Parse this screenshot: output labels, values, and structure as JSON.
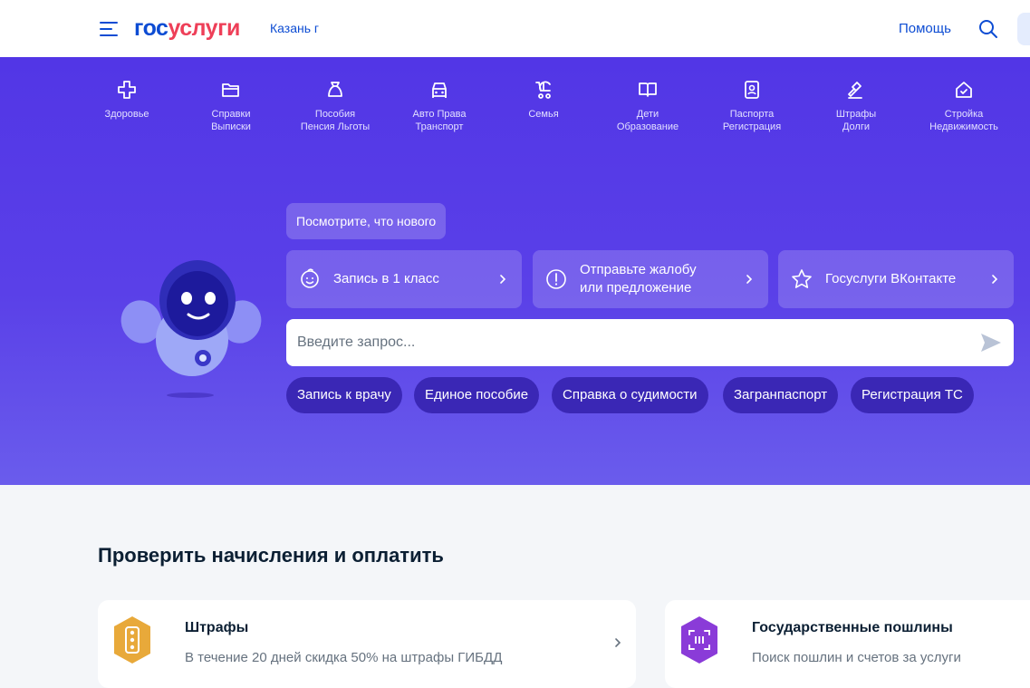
{
  "header": {
    "logo_part1": "гос",
    "logo_part2": "услуги",
    "city": "Казань г",
    "help": "Помощь"
  },
  "categories": [
    {
      "icon": "plus-cross-icon",
      "line1": "Здоровье",
      "line2": ""
    },
    {
      "icon": "folder-icon",
      "line1": "Справки",
      "line2": "Выписки"
    },
    {
      "icon": "money-bag-icon",
      "line1": "Пособия",
      "line2": "Пенсия Льготы"
    },
    {
      "icon": "car-icon",
      "line1": "Авто Права",
      "line2": "Транспорт"
    },
    {
      "icon": "stroller-icon",
      "line1": "Семья",
      "line2": ""
    },
    {
      "icon": "book-icon",
      "line1": "Дети",
      "line2": "Образование"
    },
    {
      "icon": "passport-icon",
      "line1": "Паспорта",
      "line2": "Регистрация"
    },
    {
      "icon": "gavel-icon",
      "line1": "Штрафы",
      "line2": "Долги"
    },
    {
      "icon": "house-icon",
      "line1": "Стройка",
      "line2": "Недвижимость"
    }
  ],
  "hero": {
    "news_chip": "Посмотрите, что нового",
    "promos": [
      {
        "icon": "child-face-icon",
        "line1": "Запись в 1 класс",
        "line2": ""
      },
      {
        "icon": "exclamation-circle-icon",
        "line1": "Отправьте жалобу",
        "line2": "или предложение"
      },
      {
        "icon": "star-icon",
        "line1": "Госуслуги ВКонтакте",
        "line2": ""
      }
    ],
    "search_placeholder": "Введите запрос...",
    "quick_links": [
      "Запись к врачу",
      "Единое пособие",
      "Справка о судимости",
      "Загранпаспорт",
      "Регистрация ТС"
    ]
  },
  "payments": {
    "title": "Проверить начисления и оплатить",
    "cards": [
      {
        "icon": "traffic-light-icon",
        "title": "Штрафы",
        "subtitle": "В течение 20 дней скидка 50% на штрафы ГИБДД"
      },
      {
        "icon": "barcode-scan-icon",
        "title": "Государственные пошлины",
        "subtitle": "Поиск пошлин и счетов за услуги"
      }
    ]
  },
  "colors": {
    "brand_blue": "#0d4cd3",
    "brand_red": "#ee3f58",
    "hero_purple": "#5236e6",
    "quick_link_bg": "#3a27b5",
    "fines_icon": "#e8a93a",
    "duties_icon": "#8a3bd8"
  }
}
